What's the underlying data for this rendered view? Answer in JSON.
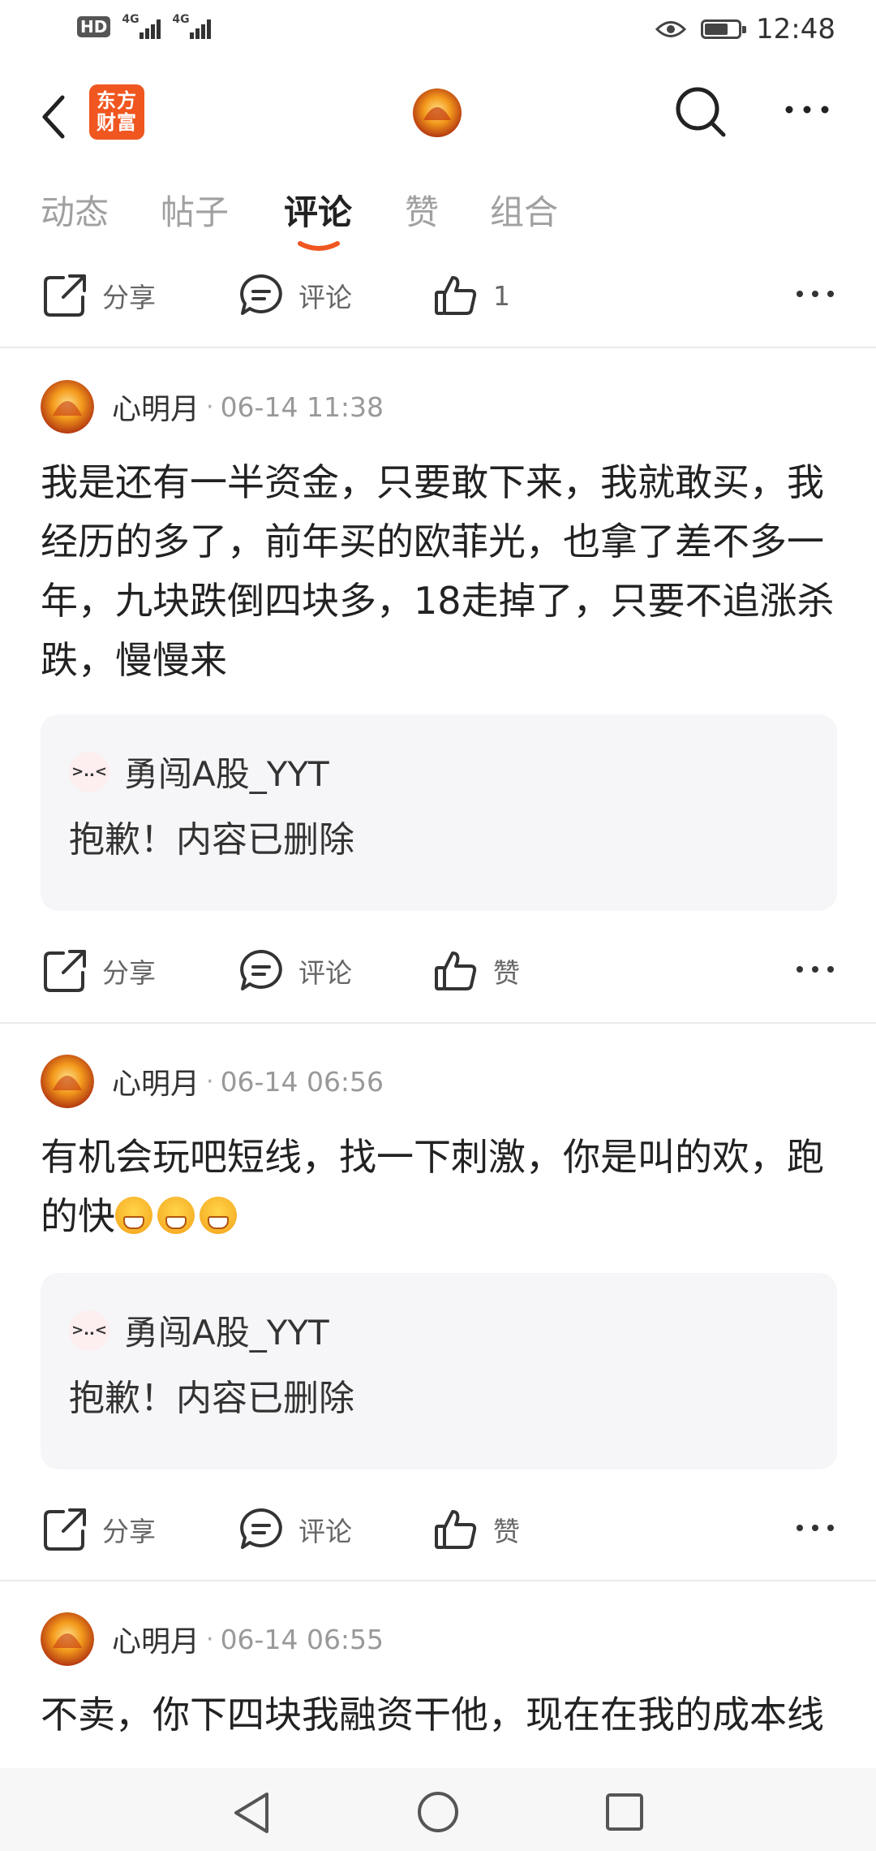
{
  "status_bar": {
    "time": "12:48",
    "network_badge": "HD",
    "signal1": "4G",
    "signal2": "4G",
    "battery_level": 0.7
  },
  "header": {
    "logo_line1": "东方",
    "logo_line2": "财富",
    "icons": [
      "back-arrow-icon",
      "search-icon",
      "more-icon"
    ]
  },
  "tabs": [
    {
      "label": "动态",
      "active": false
    },
    {
      "label": "帖子",
      "active": false
    },
    {
      "label": "评论",
      "active": true
    },
    {
      "label": "赞",
      "active": false
    },
    {
      "label": "组合",
      "active": false
    }
  ],
  "top_actions": {
    "share": "分享",
    "comment": "评论",
    "like": "1"
  },
  "posts": [
    {
      "author": "心明月",
      "sep": "·",
      "time": "06-14 11:38",
      "content": "我是还有一半资金，只要敢下来，我就敢买，我经历的多了，前年买的欧菲光，也拿了差不多一年，九块跌倒四块多，18走掉了，只要不追涨杀跌，慢慢来",
      "quote": {
        "avatar_text": ">..<",
        "user": "勇闯A股_YYT",
        "text": "抱歉！内容已删除"
      },
      "actions": {
        "share": "分享",
        "comment": "评论",
        "like": "赞"
      }
    },
    {
      "author": "心明月",
      "sep": "·",
      "time": "06-14 06:56",
      "content": "有机会玩吧短线，找一下刺激，你是叫的欢，跑的快",
      "emoji_count": 3,
      "quote": {
        "avatar_text": ">..<",
        "user": "勇闯A股_YYT",
        "text": "抱歉！内容已删除"
      },
      "actions": {
        "share": "分享",
        "comment": "评论",
        "like": "赞"
      }
    },
    {
      "author": "心明月",
      "sep": "·",
      "time": "06-14 06:55",
      "content": "不卖，你下四块我融资干他，现在在我的成本线"
    }
  ],
  "colors": {
    "accent": "#f0561f",
    "tab_inactive": "#a0a0a0",
    "quote_bg": "#f6f6f8"
  }
}
